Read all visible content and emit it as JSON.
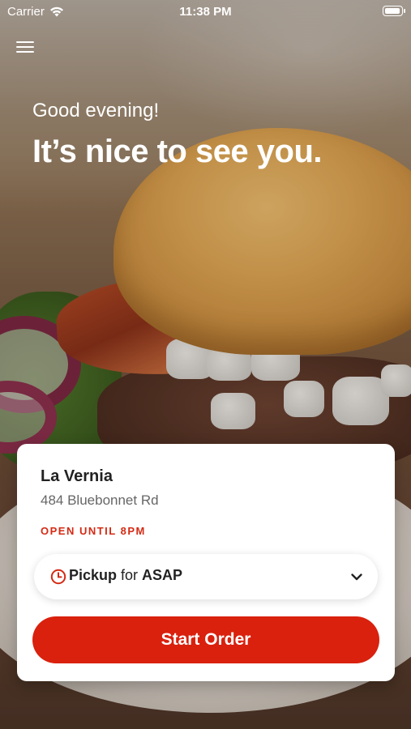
{
  "status_bar": {
    "carrier": "Carrier",
    "time": "11:38 PM",
    "icons": [
      "wifi-icon",
      "battery-icon"
    ]
  },
  "header": {
    "greeting": "Good evening!",
    "headline": "It’s nice to see you.",
    "menu_icon": "hamburger-menu-icon"
  },
  "store": {
    "name": "La Vernia",
    "address": "484 Bluebonnet Rd",
    "hours": "OPEN UNTIL 8PM"
  },
  "order_type": {
    "method": "Pickup",
    "connector": " for ",
    "time": "ASAP",
    "icons": [
      "clock-icon",
      "chevron-down-icon"
    ]
  },
  "cta": {
    "label": "Start Order"
  },
  "colors": {
    "accent": "#d9210e",
    "hours_text": "#d42a14"
  }
}
